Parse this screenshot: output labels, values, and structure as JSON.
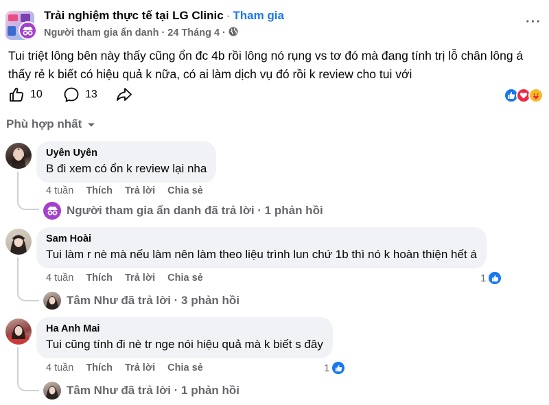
{
  "post": {
    "group_name": "Trải nghiệm thực tế tại LG Clinic",
    "separator": "·",
    "join_label": "Tham gia",
    "author": "Người tham gia ẩn danh",
    "date": "24 Tháng 4",
    "meta_separator": "·",
    "more_icon": "more-horizontal-icon",
    "privacy_icon": "globe-icon",
    "text": "Tui triệt lông bên này thấy cũng ổn đc 4b rồi lông nó rụng vs tơ đó mà đang tính trị lỗ chân lông á thấy rẻ k biết có hiệu quả k nữa, có ai làm dịch vụ đó rồi k review cho tui với",
    "like_count": "10",
    "comment_count": "13",
    "reactions": [
      "like-icon",
      "love-icon",
      "care-icon"
    ],
    "reaction_colors": {
      "like": "#1877f2",
      "love": "#f02849",
      "care": "#f7b928"
    }
  },
  "sort": {
    "label": "Phù hợp nhất",
    "icon": "caret-down-icon"
  },
  "comments": [
    {
      "name": "Uyên Uyên",
      "text": "B đi xem có ổn k review lại nha",
      "time": "4 tuần",
      "like_label": "Thích",
      "reply_label": "Trả lời",
      "share_label": "Chia sẻ",
      "likes": "",
      "reply_summary": "Người tham gia ẩn danh đã trả lời · 1 phản hồi"
    },
    {
      "name": "Sam Hoài",
      "text": "Tui làm r nè mà nếu làm nên làm theo liệu trình lun chứ 1b thì nó k hoàn thiện hết á",
      "time": "4 tuần",
      "like_label": "Thích",
      "reply_label": "Trả lời",
      "share_label": "Chia sẻ",
      "likes": "1",
      "reply_summary": "Tâm Như đã trả lời · 3 phản hồi"
    },
    {
      "name": "Ha Anh Mai",
      "text": "Tui cũng tính đi nè tr nge nói hiệu quả mà k biết s đây",
      "time": "4 tuần",
      "like_label": "Thích",
      "reply_label": "Trả lời",
      "share_label": "Chia sẻ",
      "likes": "1",
      "reply_summary": "Tâm Như đã trả lời · 1 phản hồi"
    }
  ]
}
